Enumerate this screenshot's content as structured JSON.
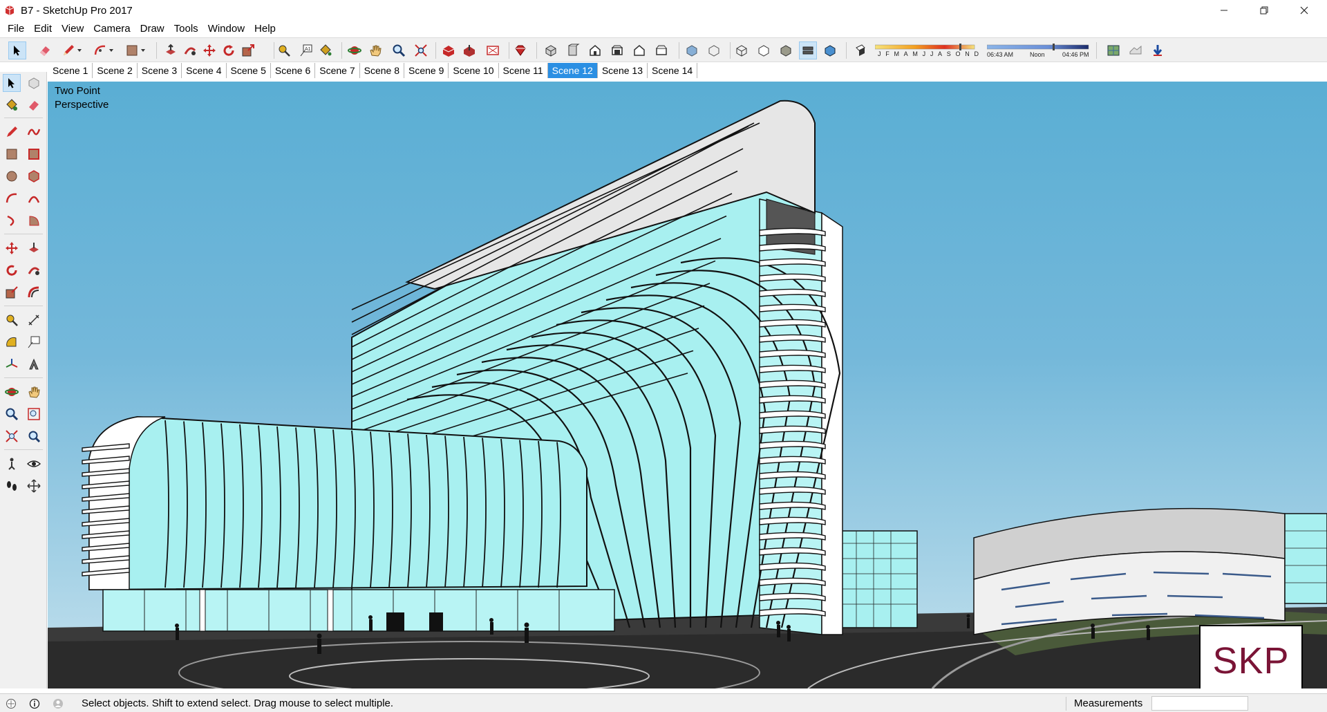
{
  "window": {
    "title": "B7 - SketchUp Pro 2017",
    "minimize_icon": "minimize-icon",
    "maximize_icon": "restore-icon",
    "close_icon": "close-icon"
  },
  "menu": [
    {
      "label": "File"
    },
    {
      "label": "Edit"
    },
    {
      "label": "View"
    },
    {
      "label": "Camera"
    },
    {
      "label": "Draw"
    },
    {
      "label": "Tools"
    },
    {
      "label": "Window"
    },
    {
      "label": "Help"
    }
  ],
  "shadow_settings": {
    "months": [
      "J",
      "F",
      "M",
      "A",
      "M",
      "J",
      "J",
      "A",
      "S",
      "O",
      "N",
      "D"
    ],
    "time_start": "06:43 AM",
    "time_noon": "Noon",
    "time_end": "04:46 PM"
  },
  "scenes": [
    {
      "label": "Scene 1"
    },
    {
      "label": "Scene 2"
    },
    {
      "label": "Scene 3"
    },
    {
      "label": "Scene 4"
    },
    {
      "label": "Scene 5"
    },
    {
      "label": "Scene 6"
    },
    {
      "label": "Scene 7"
    },
    {
      "label": "Scene 8"
    },
    {
      "label": "Scene 9"
    },
    {
      "label": "Scene 10"
    },
    {
      "label": "Scene 11"
    },
    {
      "label": "Scene 12"
    },
    {
      "label": "Scene 13"
    },
    {
      "label": "Scene 14"
    }
  ],
  "active_scene": "Scene 12",
  "viewport": {
    "camera_label_line1": "Two Point",
    "camera_label_line2": "Perspective",
    "watermark": "SKP"
  },
  "status": {
    "hint": "Select objects. Shift to extend select. Drag mouse to select multiple.",
    "measurements_label": "Measurements",
    "measurements_value": ""
  },
  "colors": {
    "sky_top": "#5aaed4",
    "glass": "#a8f0f0",
    "active_tab": "#2b8fe3",
    "skp_text": "#7a1436"
  }
}
